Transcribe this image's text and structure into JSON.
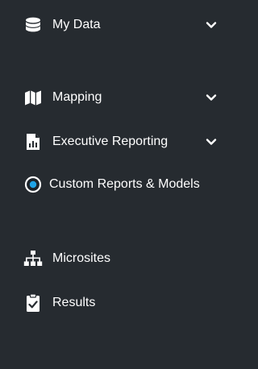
{
  "colors": {
    "background": "#262b30",
    "text": "#ffffff",
    "icon": "#ffffff",
    "radio_accent": "#1fa3e6"
  },
  "nav": {
    "items": [
      {
        "label": "My Data",
        "icon": "database-icon",
        "expandable": true
      },
      {
        "label": "Mapping",
        "icon": "map-icon",
        "expandable": true
      },
      {
        "label": "Executive Reporting",
        "icon": "report-icon",
        "expandable": true
      },
      {
        "label": "Custom Reports & Models",
        "icon": "radio-selected-icon",
        "expandable": false
      },
      {
        "label": "Microsites",
        "icon": "sitemap-icon",
        "expandable": false
      },
      {
        "label": "Results",
        "icon": "clipboard-check-icon",
        "expandable": false
      }
    ]
  }
}
